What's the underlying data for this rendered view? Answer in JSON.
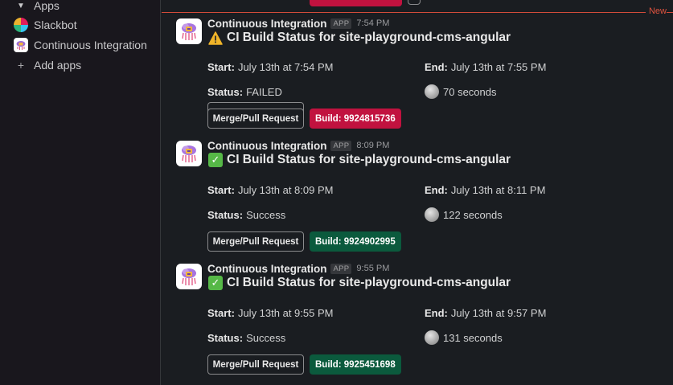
{
  "sidebar": {
    "apps_section_label": "Apps",
    "items": [
      {
        "label": "Slackbot",
        "icon": "slackbot-icon"
      },
      {
        "label": "Continuous Integration",
        "icon": "ci-app-icon"
      }
    ],
    "add_apps_label": "Add apps"
  },
  "divider": {
    "new_label": "New"
  },
  "messages": [
    {
      "sender": "Continuous Integration",
      "badge": "APP",
      "time": "7:54 PM",
      "status_icon": "warning-icon",
      "title": "CI Build Status for site-playground-cms-angular",
      "start_label": "Start:",
      "start_value": "July 13th at 7:54 PM",
      "end_label": "End:",
      "end_value": "July 13th at 7:55 PM",
      "status_label": "Status:",
      "status_value": "FAILED",
      "duration_value": "70 seconds",
      "merge_button_label": "Merge/Pull Request",
      "build_button_label": "Build: 9924815736",
      "build_color": "#c1123f"
    },
    {
      "sender": "Continuous Integration",
      "badge": "APP",
      "time": "8:09 PM",
      "status_icon": "check-icon",
      "title": "CI Build Status for site-playground-cms-angular",
      "start_label": "Start:",
      "start_value": "July 13th at 8:09 PM",
      "end_label": "End:",
      "end_value": "July 13th at 8:11 PM",
      "status_label": "Status:",
      "status_value": "Success",
      "duration_value": "122 seconds",
      "merge_button_label": "Merge/Pull Request",
      "build_button_label": "Build: 9924902995",
      "build_color": "#0b5a3d"
    },
    {
      "sender": "Continuous Integration",
      "badge": "APP",
      "time": "9:55 PM",
      "status_icon": "check-icon",
      "title": "CI Build Status for site-playground-cms-angular",
      "start_label": "Start:",
      "start_value": "July 13th at 9:55 PM",
      "end_label": "End:",
      "end_value": "July 13th at 9:57 PM",
      "status_label": "Status:",
      "status_value": "Success",
      "duration_value": "131 seconds",
      "merge_button_label": "Merge/Pull Request",
      "build_button_label": "Build: 9925451698",
      "build_color": "#0b5a3d"
    }
  ]
}
